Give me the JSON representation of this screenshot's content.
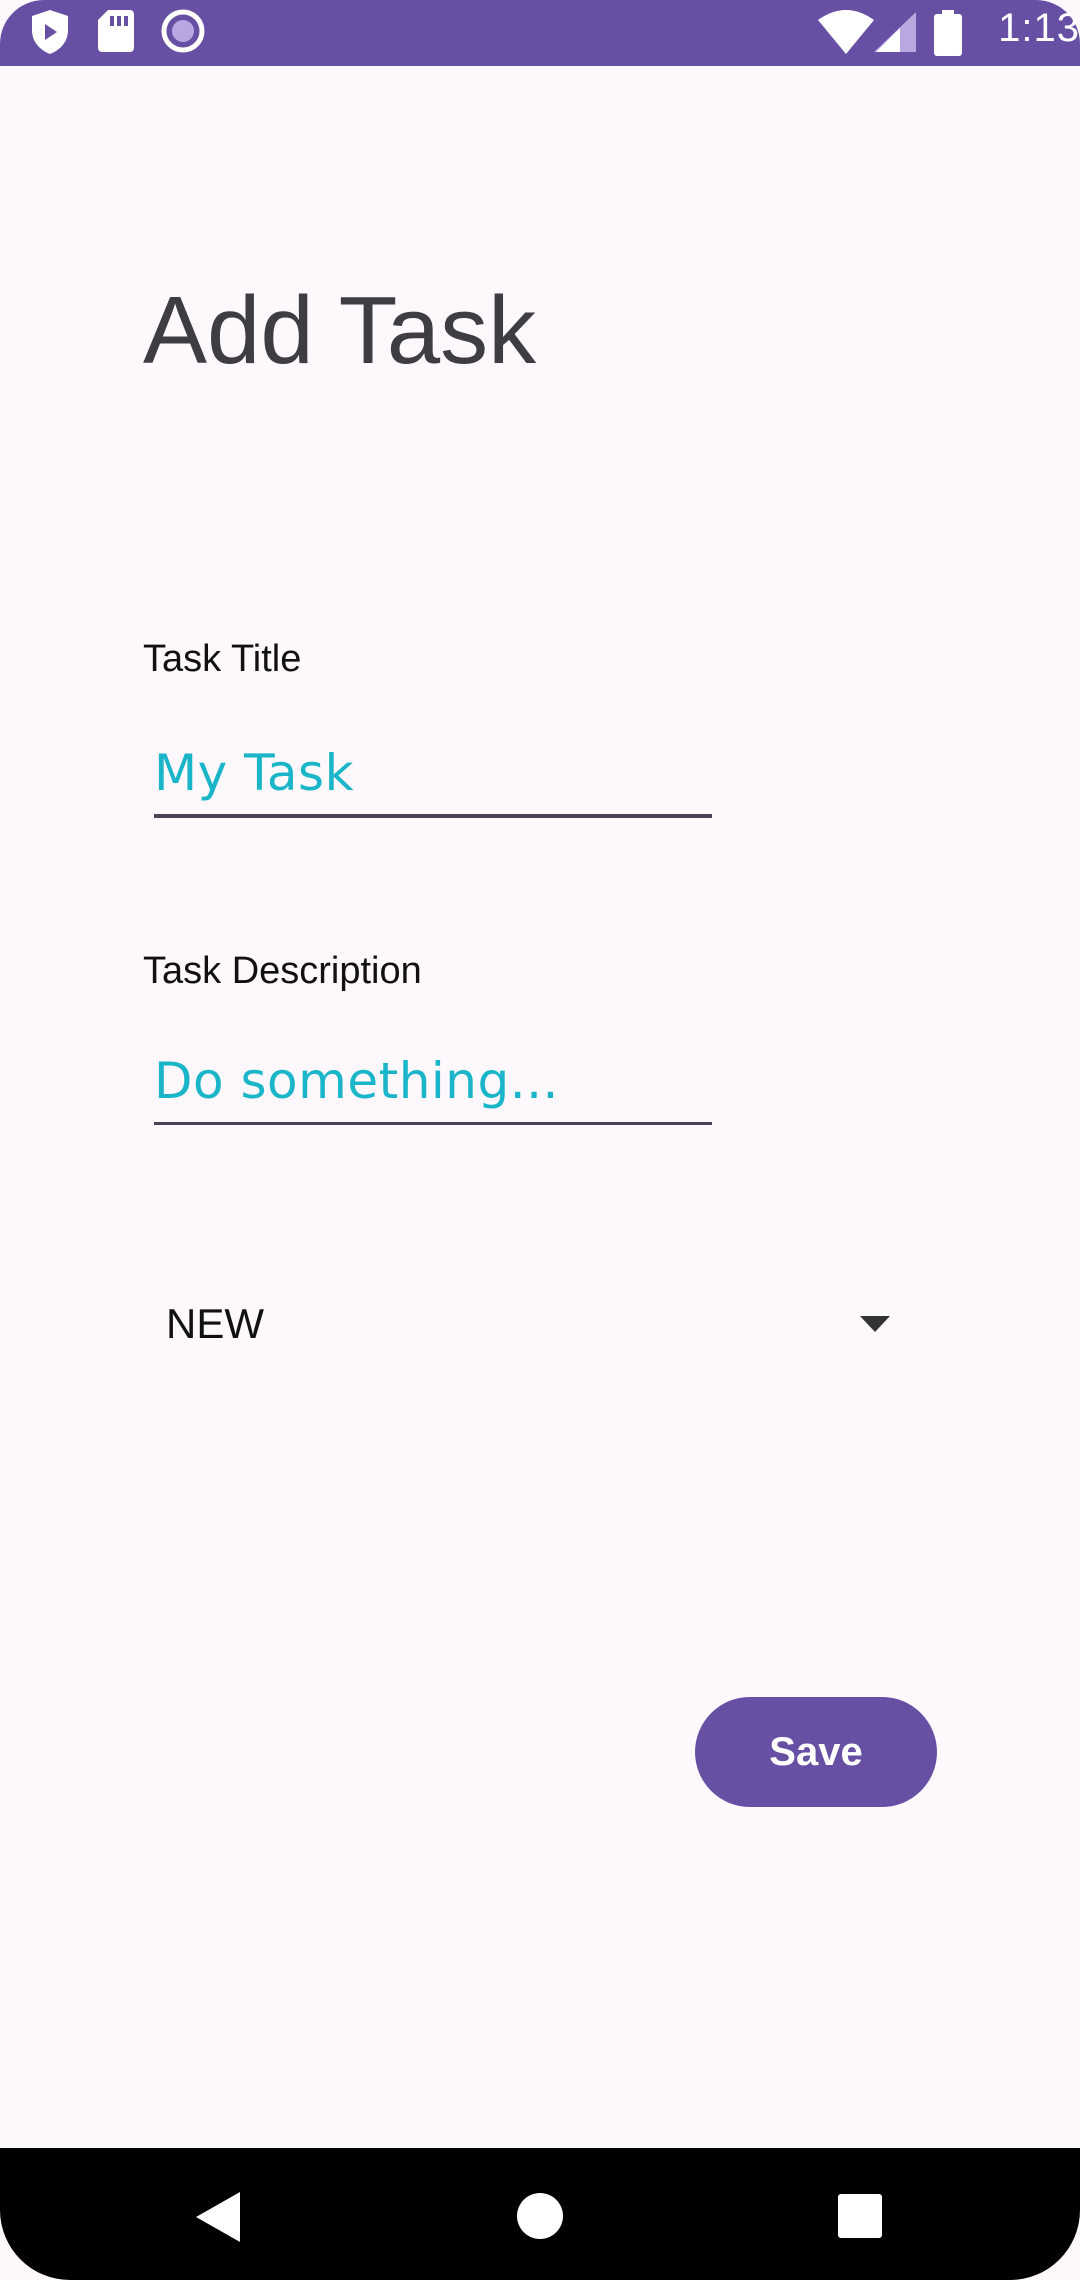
{
  "status_bar": {
    "time": "1:13",
    "icons": [
      "shield-icon",
      "sd-card-icon",
      "record-icon",
      "wifi-icon",
      "signal-icon",
      "battery-icon"
    ],
    "background_color": "#6750a4"
  },
  "page": {
    "title": "Add Task"
  },
  "form": {
    "task_title": {
      "label": "Task Title",
      "value": "My Task"
    },
    "task_description": {
      "label": "Task Description",
      "value": "Do something..."
    },
    "status_dropdown": {
      "selected": "NEW"
    },
    "save_label": "Save"
  },
  "nav_bar": {
    "icons": [
      "back-icon",
      "home-icon",
      "recents-icon"
    ]
  },
  "colors": {
    "accent": "#6750a4",
    "input_text": "#1ab5c9",
    "background": "#fdf8fb"
  }
}
